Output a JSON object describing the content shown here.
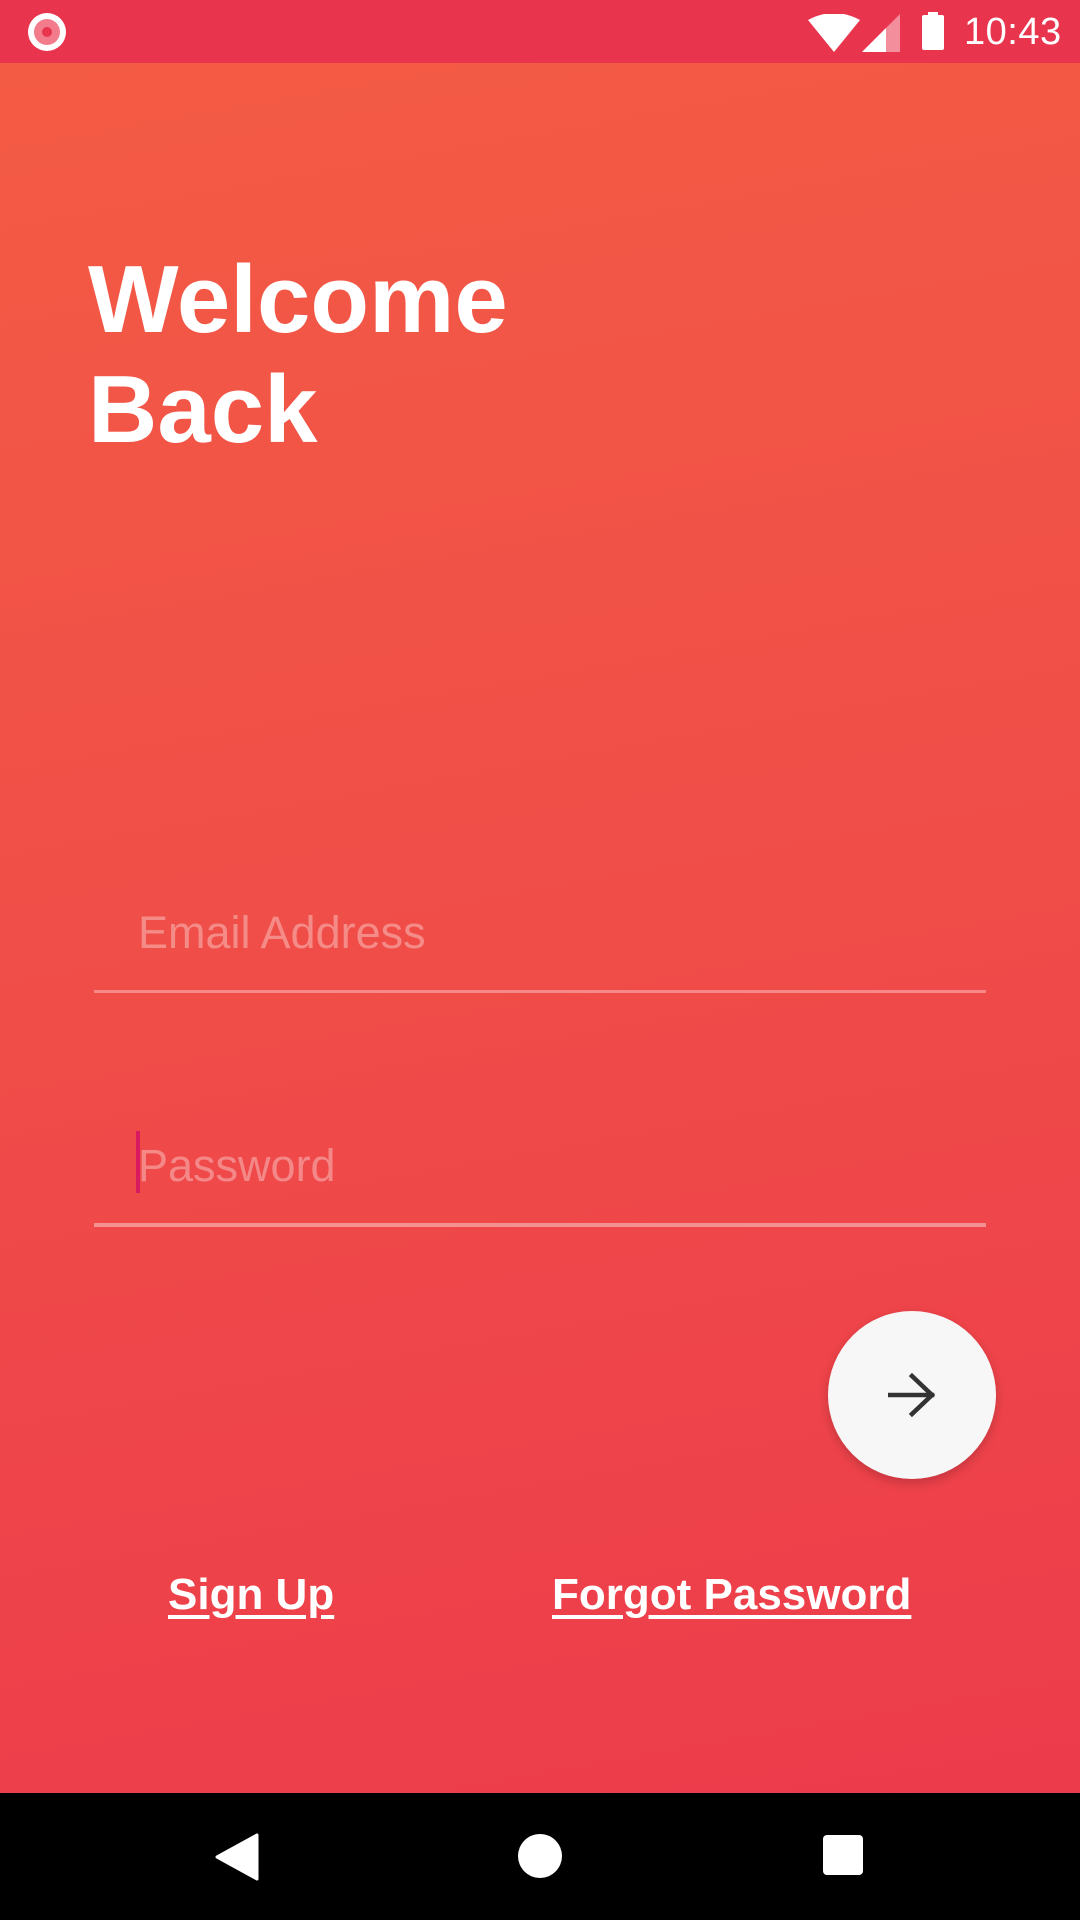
{
  "status_bar": {
    "time": "10:43",
    "icons": [
      "screen-record-icon",
      "wifi-icon",
      "cellular-signal-icon",
      "battery-icon"
    ]
  },
  "title": {
    "line1": "Welcome",
    "line2": "Back"
  },
  "form": {
    "email": {
      "placeholder": "Email Address",
      "value": ""
    },
    "password": {
      "placeholder": "Password",
      "value": ""
    },
    "submit_icon": "arrow-right-icon"
  },
  "links": {
    "sign_up": "Sign Up",
    "forgot_password": "Forgot Password"
  },
  "nav_bar": {
    "icons": [
      "back-icon",
      "home-icon",
      "recents-icon"
    ]
  },
  "colors": {
    "status_bar": "#e9344e",
    "gradient_top": "#f45c44",
    "gradient_bottom": "#ec394c",
    "fab": "#f7f7f7",
    "caret": "#d81b60"
  }
}
